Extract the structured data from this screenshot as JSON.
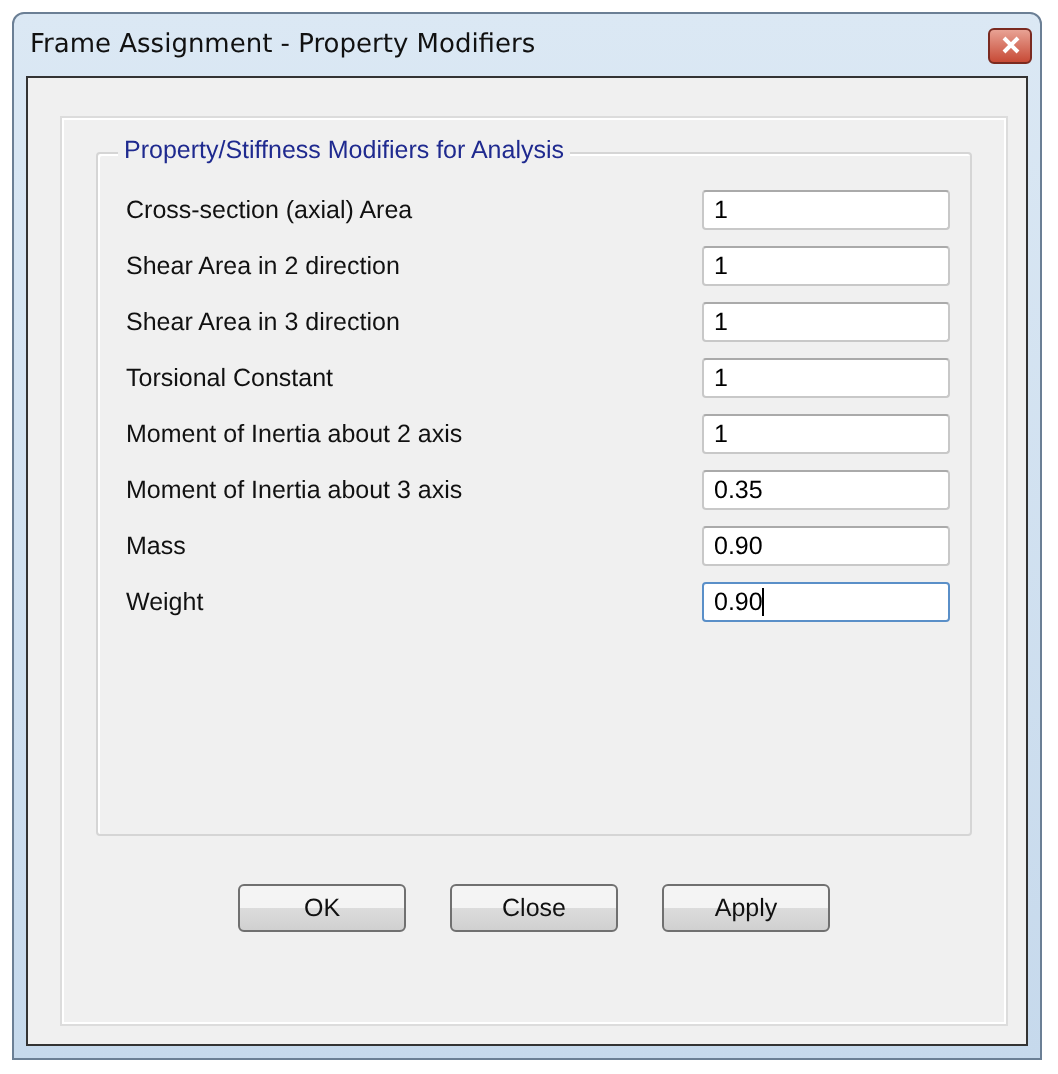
{
  "window": {
    "title": "Frame Assignment - Property Modifiers"
  },
  "group": {
    "title": "Property/Stiffness Modifiers for Analysis",
    "fields": [
      {
        "label": "Cross-section (axial) Area",
        "value": "1",
        "focused": false
      },
      {
        "label": "Shear Area in 2 direction",
        "value": "1",
        "focused": false
      },
      {
        "label": "Shear Area in 3 direction",
        "value": "1",
        "focused": false
      },
      {
        "label": "Torsional Constant",
        "value": "1",
        "focused": false
      },
      {
        "label": "Moment of Inertia about 2 axis",
        "value": "1",
        "focused": false
      },
      {
        "label": "Moment of Inertia about 3 axis",
        "value": "0.35",
        "focused": false
      },
      {
        "label": "Mass",
        "value": "0.90",
        "focused": false
      },
      {
        "label": "Weight",
        "value": "0.90",
        "focused": true
      }
    ]
  },
  "buttons": [
    "OK",
    "Close",
    "Apply"
  ]
}
